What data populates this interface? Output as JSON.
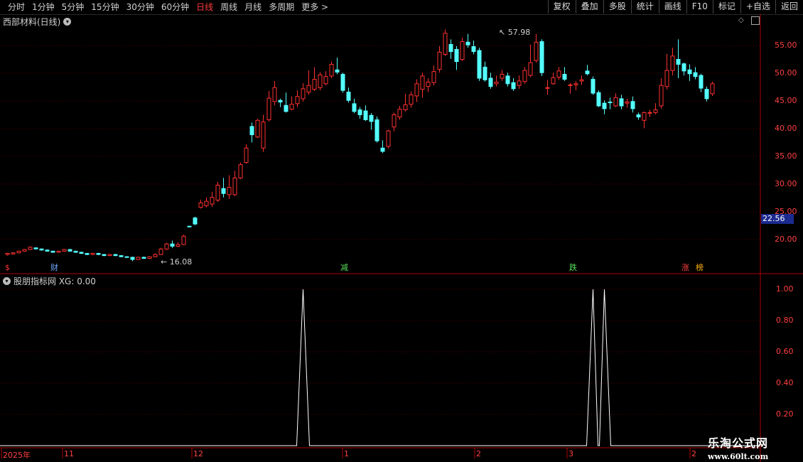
{
  "toolbar": {
    "periods": [
      "分时",
      "1分钟",
      "5分钟",
      "15分钟",
      "30分钟",
      "60分钟",
      "日线",
      "周线",
      "月线",
      "多周期",
      "更多 >"
    ],
    "active_period": "日线",
    "buttons": [
      "复权",
      "叠加",
      "多股",
      "统计",
      "画线",
      "F10",
      "标记",
      "+自选",
      "返回"
    ]
  },
  "main": {
    "title": "西部材料(日线)",
    "price_axis": [
      "55.00",
      "50.00",
      "45.00",
      "40.00",
      "35.00",
      "30.00",
      "25.00",
      "20.00"
    ],
    "current_price": "22.56",
    "high_label": "57.98",
    "low_label": "16.08",
    "events": [
      {
        "text": "$",
        "color": "#ff3030"
      },
      {
        "text": "财",
        "color": "#6fa8ff"
      },
      {
        "text": "减",
        "color": "#58e058"
      },
      {
        "text": "跌",
        "color": "#58e058"
      },
      {
        "text": "涨",
        "color": "#ff4040"
      },
      {
        "text": "榜",
        "color": "#ffb000"
      }
    ]
  },
  "indicator": {
    "title": "股朋指标网 XG: 0.00",
    "axis": [
      "1.00",
      "0.80",
      "0.60",
      "0.40",
      "0.20"
    ],
    "signals": [
      {
        "index": 52,
        "value": 1.0
      },
      {
        "index": 103,
        "value": 1.0
      },
      {
        "index": 105,
        "value": 1.0
      }
    ]
  },
  "time_axis": [
    "2025年",
    "11",
    "12",
    "1",
    "2",
    "3",
    "2"
  ],
  "colors": {
    "up": "#ff3030",
    "down": "#54ffff",
    "axis": "#b00000",
    "grid": "#5a0000"
  },
  "chart_data": {
    "type": "candlestick",
    "title": "西部材料(日线)",
    "ylim": [
      15,
      60
    ],
    "candles": [
      [
        17.3,
        17.5,
        17.1,
        17.6
      ],
      [
        17.4,
        17.6,
        17.3,
        17.7
      ],
      [
        17.6,
        17.9,
        17.5,
        18.0
      ],
      [
        17.9,
        18.2,
        17.8,
        18.3
      ],
      [
        18.2,
        18.6,
        18.1,
        18.8
      ],
      [
        18.5,
        18.3,
        18.2,
        18.6
      ],
      [
        18.3,
        18.1,
        18.0,
        18.4
      ],
      [
        18.1,
        17.9,
        17.8,
        18.2
      ],
      [
        17.9,
        17.7,
        17.6,
        18.0
      ],
      [
        17.7,
        17.9,
        17.6,
        18.0
      ],
      [
        17.9,
        18.2,
        17.8,
        18.3
      ],
      [
        18.2,
        17.9,
        17.8,
        18.3
      ],
      [
        17.9,
        17.7,
        17.6,
        18.0
      ],
      [
        17.7,
        17.5,
        17.4,
        17.8
      ],
      [
        17.5,
        17.3,
        17.2,
        17.6
      ],
      [
        17.3,
        17.5,
        17.2,
        17.6
      ],
      [
        17.5,
        17.3,
        17.2,
        17.6
      ],
      [
        17.3,
        17.1,
        17.0,
        17.4
      ],
      [
        17.1,
        17.3,
        17.0,
        17.4
      ],
      [
        17.3,
        17.1,
        17.0,
        17.4
      ],
      [
        17.1,
        16.9,
        16.8,
        17.2
      ],
      [
        16.9,
        16.8,
        16.7,
        17.0
      ],
      [
        16.8,
        16.4,
        16.1,
        16.9
      ],
      [
        16.4,
        16.8,
        16.3,
        16.9
      ],
      [
        16.8,
        16.6,
        16.5,
        16.9
      ],
      [
        16.6,
        16.9,
        16.5,
        17.0
      ],
      [
        16.9,
        17.3,
        16.8,
        17.5
      ],
      [
        17.3,
        18.3,
        17.2,
        18.5
      ],
      [
        18.3,
        19.2,
        18.1,
        19.4
      ],
      [
        19.2,
        18.8,
        18.5,
        19.8
      ],
      [
        18.8,
        19.1,
        18.6,
        19.5
      ],
      [
        19.1,
        20.6,
        19.0,
        20.9
      ],
      [
        22.4,
        22.3,
        22.2,
        22.5
      ],
      [
        23.9,
        22.8,
        22.6,
        24.1
      ],
      [
        25.8,
        26.6,
        25.6,
        27.2
      ],
      [
        26.1,
        26.9,
        25.8,
        27.6
      ],
      [
        26.4,
        27.6,
        25.9,
        28.6
      ],
      [
        27.1,
        29.8,
        26.8,
        30.4
      ],
      [
        29.2,
        28.3,
        27.6,
        31.1
      ],
      [
        28.1,
        29.4,
        27.3,
        31.6
      ],
      [
        28.1,
        31.1,
        27.8,
        32.4
      ],
      [
        31.1,
        33.5,
        30.9,
        33.9
      ],
      [
        33.9,
        36.5,
        33.7,
        37.2
      ],
      [
        40.4,
        38.9,
        37.5,
        41.1
      ],
      [
        38.5,
        41.5,
        38.3,
        41.8
      ],
      [
        36.5,
        41.2,
        35.8,
        42.5
      ],
      [
        41.6,
        45.5,
        41.3,
        46.8
      ],
      [
        44.9,
        47.4,
        44.2,
        48.6
      ],
      [
        45.1,
        44.8,
        43.9,
        45.4
      ],
      [
        44.2,
        43.1,
        42.9,
        46.5
      ],
      [
        43.5,
        44.4,
        43.3,
        45.8
      ],
      [
        44.5,
        45.8,
        43.9,
        46.9
      ],
      [
        45.4,
        47.2,
        44.9,
        48.2
      ],
      [
        46.6,
        47.8,
        46.1,
        50.5
      ],
      [
        47.1,
        48.9,
        46.8,
        51.1
      ],
      [
        47.4,
        49.7,
        46.9,
        50.2
      ],
      [
        48.1,
        49.4,
        47.8,
        50.4
      ],
      [
        49.5,
        51.6,
        49.1,
        52.1
      ],
      [
        50.6,
        50.2,
        49.8,
        52.8
      ],
      [
        49.8,
        46.9,
        46.5,
        50.1
      ],
      [
        46.6,
        45.1,
        44.7,
        47.4
      ],
      [
        44.5,
        43.1,
        42.8,
        45.4
      ],
      [
        43.4,
        42.5,
        41.8,
        43.9
      ],
      [
        43.2,
        41.6,
        41.4,
        44.2
      ],
      [
        42.4,
        41.3,
        39.8,
        42.8
      ],
      [
        41.6,
        37.8,
        37.5,
        42.2
      ],
      [
        36.5,
        35.9,
        35.6,
        37.9
      ],
      [
        36.8,
        39.6,
        36.4,
        39.8
      ],
      [
        40.3,
        42.5,
        39.5,
        42.9
      ],
      [
        42.1,
        43.5,
        41.6,
        44.1
      ],
      [
        43.4,
        44.3,
        43.1,
        46.3
      ],
      [
        44.4,
        46.1,
        43.8,
        46.7
      ],
      [
        45.9,
        48.1,
        44.8,
        48.9
      ],
      [
        47.1,
        49.5,
        45.6,
        50.1
      ],
      [
        47.6,
        48.4,
        46.6,
        49.1
      ],
      [
        48.3,
        50.3,
        47.8,
        51.4
      ],
      [
        50.7,
        53.8,
        50.1,
        54.9
      ],
      [
        53.4,
        57.2,
        53.1,
        57.9
      ],
      [
        55.2,
        53.9,
        52.6,
        56.1
      ],
      [
        54.3,
        52.1,
        50.6,
        54.9
      ],
      [
        52.5,
        55.7,
        52.2,
        56.4
      ],
      [
        55.6,
        55.1,
        54.6,
        57.1
      ],
      [
        54.8,
        53.9,
        53.4,
        55.9
      ],
      [
        54.1,
        49.1,
        48.6,
        54.6
      ],
      [
        51.1,
        48.8,
        48.5,
        52.1
      ],
      [
        49.1,
        47.6,
        47.2,
        50.1
      ],
      [
        48.1,
        48.4,
        47.6,
        49.6
      ],
      [
        49.1,
        49.8,
        48.6,
        50.6
      ],
      [
        49.5,
        48.1,
        47.6,
        50.1
      ],
      [
        48.3,
        47.2,
        46.8,
        49.1
      ],
      [
        47.8,
        48.6,
        47.2,
        49.6
      ],
      [
        48.5,
        50.5,
        48.1,
        51.1
      ],
      [
        49.6,
        51.9,
        49.3,
        55.2
      ],
      [
        52.3,
        55.6,
        51.9,
        57.1
      ],
      [
        55.7,
        50.1,
        49.5,
        56.1
      ],
      [
        47.3,
        47.4,
        46.1,
        48.8
      ],
      [
        48.1,
        49.2,
        47.9,
        50.1
      ],
      [
        49.3,
        50.4,
        48.8,
        51.1
      ],
      [
        49.8,
        48.9,
        48.6,
        51.1
      ],
      [
        47.9,
        47.9,
        46.3,
        48.2
      ],
      [
        47.9,
        48.1,
        46.9,
        48.6
      ],
      [
        48.6,
        48.8,
        47.9,
        49.6
      ],
      [
        50.4,
        49.9,
        49.6,
        51.5
      ],
      [
        48.9,
        46.4,
        46.1,
        49.4
      ],
      [
        46.5,
        44.1,
        43.9,
        46.9
      ],
      [
        44.6,
        43.6,
        42.6,
        45.1
      ],
      [
        44.8,
        44.7,
        43.5,
        45.6
      ],
      [
        44.1,
        45.6,
        43.9,
        46.4
      ],
      [
        45.4,
        44.1,
        43.5,
        46.1
      ],
      [
        44.6,
        44.8,
        43.8,
        45.4
      ],
      [
        44.9,
        43.6,
        42.9,
        45.8
      ],
      [
        42.5,
        42.1,
        41.6,
        42.9
      ],
      [
        41.5,
        42.9,
        40.1,
        43.1
      ],
      [
        42.8,
        42.9,
        42.1,
        43.4
      ],
      [
        42.9,
        43.4,
        42.6,
        44.6
      ],
      [
        44.1,
        47.8,
        43.6,
        49.1
      ],
      [
        47.6,
        50.5,
        47.1,
        53.5
      ],
      [
        50.5,
        53.1,
        49.6,
        54.6
      ],
      [
        52.5,
        51.6,
        49.1,
        56.1
      ],
      [
        51.7,
        50.4,
        49.6,
        51.9
      ],
      [
        50.6,
        49.9,
        48.6,
        51.6
      ],
      [
        50.1,
        49.4,
        48.9,
        51.1
      ],
      [
        49.6,
        47.3,
        46.6,
        49.9
      ],
      [
        47.1,
        45.4,
        44.9,
        47.6
      ],
      [
        46.3,
        48.1,
        45.9,
        48.5
      ]
    ]
  }
}
